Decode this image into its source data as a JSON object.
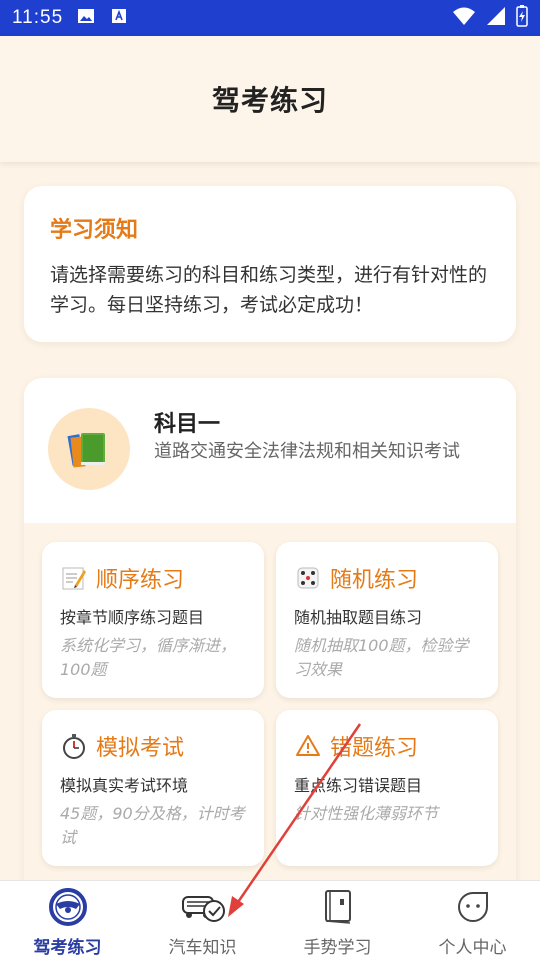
{
  "status_bar": {
    "time": "11:55"
  },
  "header": {
    "title": "驾考练习"
  },
  "notice": {
    "title": "学习须知",
    "body": "请选择需要练习的科目和练习类型，进行有针对性的学习。每日坚持练习，考试必定成功！"
  },
  "subject": {
    "title": "科目一",
    "description": "道路交通安全法律法规和相关知识考试",
    "icon": "books-icon",
    "tiles": [
      {
        "icon": "memo-icon",
        "title": "顺序练习",
        "subtitle": "按章节顺序练习题目",
        "note": "系统化学习，循序渐进，100题"
      },
      {
        "icon": "dice-icon",
        "title": "随机练习",
        "subtitle": "随机抽取题目练习",
        "note": "随机抽取100题，检验学习效果"
      },
      {
        "icon": "stopwatch-icon",
        "title": "模拟考试",
        "subtitle": "模拟真实考试环境",
        "note": "45题，90分及格，计时考试"
      },
      {
        "icon": "warning-icon",
        "title": "错题练习",
        "subtitle": "重点练习错误题目",
        "note": "针对性强化薄弱环节"
      }
    ]
  },
  "bottom_nav": {
    "items": [
      {
        "label": "驾考练习",
        "icon": "steering-wheel-icon",
        "active": true
      },
      {
        "label": "汽车知识",
        "icon": "car-check-icon",
        "active": false
      },
      {
        "label": "手势学习",
        "icon": "book-icon",
        "active": false
      },
      {
        "label": "个人中心",
        "icon": "smiley-face-icon",
        "active": false
      }
    ]
  },
  "colors": {
    "accent": "#e57a16",
    "nav_active": "#2a3da3",
    "status_bar": "#1f3fcf",
    "background": "#fdf3e6",
    "annotation_arrow": "#e0403a"
  }
}
